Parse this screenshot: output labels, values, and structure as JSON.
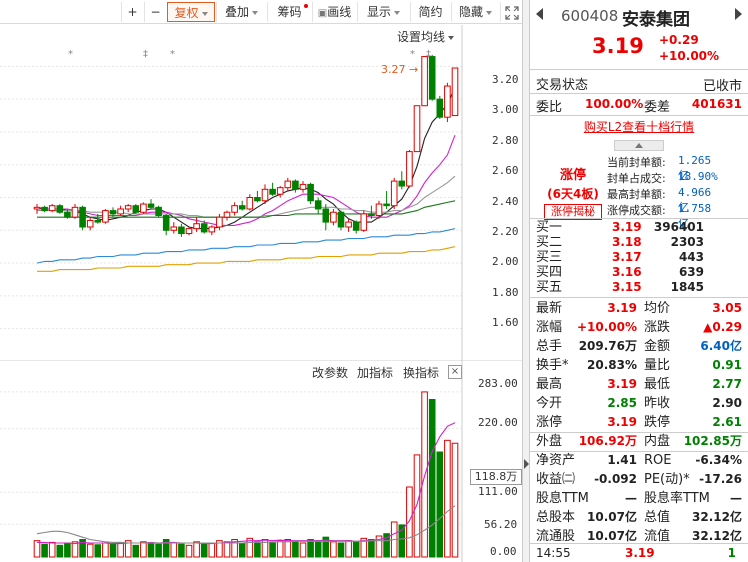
{
  "toolbar": {
    "plus": "+",
    "minus": "−",
    "fuquan": "复权",
    "diejia": "叠加",
    "chouma": "筹码",
    "huaxian": "画线",
    "xianshi": "显示",
    "jianyue": "简约",
    "yincang": "隐藏"
  },
  "chart": {
    "ma_setting": "设置均线",
    "price_high_mark": "3.27",
    "y_ticks": [
      "3.20",
      "3.00",
      "2.80",
      "2.60",
      "2.40",
      "2.20",
      "2.00",
      "1.80",
      "1.60"
    ],
    "vol_tools": {
      "params": "改参数",
      "add": "加指标",
      "swap": "换指标",
      "close": "×"
    },
    "vol_ticks": [
      "283.00",
      "220.00",
      "111.00",
      "56.20",
      "0.00"
    ],
    "vol_current": "118.8万",
    "star": "*"
  },
  "chart_data": {
    "type": "candlestick",
    "ylim": [
      1.5,
      3.3
    ],
    "y_ticks": [
      1.6,
      1.8,
      2.0,
      2.2,
      2.4,
      2.6,
      2.8,
      3.0,
      3.2
    ],
    "candles": [
      [
        2.33,
        2.36,
        2.3,
        2.34
      ],
      [
        2.34,
        2.35,
        2.31,
        2.32
      ],
      [
        2.32,
        2.36,
        2.31,
        2.35
      ],
      [
        2.35,
        2.36,
        2.3,
        2.31
      ],
      [
        2.31,
        2.33,
        2.27,
        2.28
      ],
      [
        2.28,
        2.36,
        2.27,
        2.34
      ],
      [
        2.34,
        2.35,
        2.2,
        2.22
      ],
      [
        2.22,
        2.28,
        2.2,
        2.26
      ],
      [
        2.26,
        2.3,
        2.24,
        2.25
      ],
      [
        2.25,
        2.33,
        2.24,
        2.32
      ],
      [
        2.32,
        2.34,
        2.28,
        2.3
      ],
      [
        2.3,
        2.35,
        2.29,
        2.33
      ],
      [
        2.33,
        2.36,
        2.31,
        2.35
      ],
      [
        2.35,
        2.36,
        2.3,
        2.31
      ],
      [
        2.31,
        2.37,
        2.3,
        2.36
      ],
      [
        2.36,
        2.39,
        2.33,
        2.34
      ],
      [
        2.34,
        2.35,
        2.28,
        2.29
      ],
      [
        2.29,
        2.3,
        2.17,
        2.2
      ],
      [
        2.2,
        2.25,
        2.18,
        2.22
      ],
      [
        2.22,
        2.24,
        2.16,
        2.18
      ],
      [
        2.18,
        2.22,
        2.17,
        2.21
      ],
      [
        2.21,
        2.28,
        2.19,
        2.24
      ],
      [
        2.24,
        2.26,
        2.18,
        2.19
      ],
      [
        2.19,
        2.23,
        2.17,
        2.22
      ],
      [
        2.22,
        2.3,
        2.2,
        2.28
      ],
      [
        2.28,
        2.32,
        2.26,
        2.31
      ],
      [
        2.31,
        2.37,
        2.29,
        2.35
      ],
      [
        2.35,
        2.38,
        2.32,
        2.33
      ],
      [
        2.33,
        2.42,
        2.32,
        2.4
      ],
      [
        2.4,
        2.44,
        2.37,
        2.38
      ],
      [
        2.38,
        2.48,
        2.36,
        2.45
      ],
      [
        2.45,
        2.49,
        2.41,
        2.42
      ],
      [
        2.42,
        2.47,
        2.4,
        2.46
      ],
      [
        2.46,
        2.52,
        2.44,
        2.5
      ],
      [
        2.5,
        2.51,
        2.43,
        2.45
      ],
      [
        2.45,
        2.5,
        2.43,
        2.48
      ],
      [
        2.48,
        2.49,
        2.36,
        2.38
      ],
      [
        2.38,
        2.4,
        2.3,
        2.33
      ],
      [
        2.33,
        2.36,
        2.2,
        2.25
      ],
      [
        2.25,
        2.33,
        2.23,
        2.31
      ],
      [
        2.31,
        2.32,
        2.2,
        2.22
      ],
      [
        2.22,
        2.27,
        2.19,
        2.25
      ],
      [
        2.25,
        2.26,
        2.18,
        2.2
      ],
      [
        2.2,
        2.32,
        2.19,
        2.3
      ],
      [
        2.3,
        2.35,
        2.27,
        2.29
      ],
      [
        2.29,
        2.38,
        2.27,
        2.36
      ],
      [
        2.36,
        2.44,
        2.33,
        2.35
      ],
      [
        2.35,
        2.52,
        2.33,
        2.5
      ],
      [
        2.5,
        2.56,
        2.45,
        2.47
      ],
      [
        2.47,
        2.69,
        2.46,
        2.68
      ],
      [
        2.68,
        2.96,
        2.68,
        2.96
      ],
      [
        2.96,
        3.26,
        2.96,
        3.26
      ],
      [
        3.26,
        3.27,
        2.99,
        3.0
      ],
      [
        3.0,
        3.02,
        2.88,
        2.89
      ],
      [
        2.89,
        3.1,
        2.86,
        3.08
      ],
      [
        2.9,
        3.19,
        2.9,
        3.19
      ]
    ],
    "ma": [
      {
        "color": "#222222",
        "values": [
          2.34,
          2.33,
          2.33,
          2.33,
          2.32,
          2.32,
          2.3,
          2.28,
          2.27,
          2.26,
          2.27,
          2.28,
          2.29,
          2.31,
          2.32,
          2.33,
          2.33,
          2.31,
          2.28,
          2.25,
          2.22,
          2.21,
          2.21,
          2.21,
          2.22,
          2.23,
          2.25,
          2.28,
          2.31,
          2.34,
          2.37,
          2.4,
          2.42,
          2.44,
          2.45,
          2.46,
          2.45,
          2.43,
          2.39,
          2.36,
          2.31,
          2.27,
          2.25,
          2.25,
          2.25,
          2.28,
          2.31,
          2.35,
          2.39,
          2.47,
          2.59,
          2.76,
          2.86,
          2.91,
          2.97,
          3.07
        ]
      },
      {
        "color": "#d020d0",
        "values": [
          2.33,
          2.33,
          2.33,
          2.33,
          2.33,
          2.32,
          2.31,
          2.3,
          2.29,
          2.29,
          2.29,
          2.29,
          2.29,
          2.29,
          2.3,
          2.31,
          2.31,
          2.31,
          2.3,
          2.29,
          2.27,
          2.26,
          2.25,
          2.24,
          2.23,
          2.23,
          2.23,
          2.24,
          2.25,
          2.27,
          2.3,
          2.32,
          2.35,
          2.38,
          2.4,
          2.42,
          2.42,
          2.42,
          2.41,
          2.4,
          2.37,
          2.34,
          2.31,
          2.29,
          2.28,
          2.28,
          2.28,
          2.3,
          2.32,
          2.35,
          2.41,
          2.49,
          2.55,
          2.6,
          2.66,
          2.78
        ]
      },
      {
        "color": "#999999",
        "values": [
          2.32,
          2.32,
          2.32,
          2.32,
          2.32,
          2.32,
          2.32,
          2.31,
          2.31,
          2.31,
          2.31,
          2.31,
          2.3,
          2.3,
          2.3,
          2.3,
          2.3,
          2.3,
          2.3,
          2.3,
          2.29,
          2.29,
          2.28,
          2.28,
          2.28,
          2.28,
          2.28,
          2.28,
          2.28,
          2.28,
          2.29,
          2.29,
          2.3,
          2.31,
          2.32,
          2.33,
          2.34,
          2.34,
          2.34,
          2.34,
          2.33,
          2.33,
          2.32,
          2.32,
          2.31,
          2.31,
          2.31,
          2.32,
          2.32,
          2.34,
          2.36,
          2.4,
          2.43,
          2.46,
          2.49,
          2.53
        ]
      },
      {
        "color": "#1a7a1a",
        "values": [
          2.28,
          2.28,
          2.28,
          2.28,
          2.28,
          2.28,
          2.28,
          2.28,
          2.28,
          2.28,
          2.28,
          2.28,
          2.28,
          2.28,
          2.28,
          2.28,
          2.28,
          2.28,
          2.28,
          2.28,
          2.28,
          2.28,
          2.28,
          2.28,
          2.28,
          2.28,
          2.28,
          2.28,
          2.28,
          2.28,
          2.28,
          2.29,
          2.29,
          2.29,
          2.3,
          2.3,
          2.3,
          2.3,
          2.3,
          2.3,
          2.3,
          2.3,
          2.3,
          2.3,
          2.3,
          2.3,
          2.3,
          2.3,
          2.3,
          2.31,
          2.32,
          2.34,
          2.35,
          2.36,
          2.37,
          2.38
        ]
      },
      {
        "color": "#2a8ad8",
        "values": [
          2.0,
          2.01,
          2.01,
          2.02,
          2.02,
          2.02,
          2.03,
          2.03,
          2.04,
          2.04,
          2.04,
          2.05,
          2.05,
          2.05,
          2.06,
          2.06,
          2.06,
          2.07,
          2.07,
          2.07,
          2.08,
          2.08,
          2.08,
          2.09,
          2.09,
          2.09,
          2.1,
          2.1,
          2.1,
          2.11,
          2.11,
          2.11,
          2.12,
          2.12,
          2.12,
          2.13,
          2.13,
          2.13,
          2.14,
          2.14,
          2.14,
          2.15,
          2.15,
          2.15,
          2.16,
          2.16,
          2.16,
          2.17,
          2.17,
          2.17,
          2.18,
          2.18,
          2.19,
          2.19,
          2.2,
          2.21
        ]
      },
      {
        "color": "#e0a000",
        "values": [
          1.95,
          1.95,
          1.95,
          1.96,
          1.96,
          1.96,
          1.96,
          1.96,
          1.97,
          1.97,
          1.97,
          1.97,
          1.98,
          1.98,
          1.98,
          1.98,
          1.98,
          1.99,
          1.99,
          1.99,
          1.99,
          2.0,
          2.0,
          2.0,
          2.0,
          2.01,
          2.01,
          2.01,
          2.01,
          2.02,
          2.02,
          2.02,
          2.02,
          2.03,
          2.03,
          2.03,
          2.03,
          2.04,
          2.04,
          2.04,
          2.04,
          2.05,
          2.05,
          2.05,
          2.05,
          2.06,
          2.06,
          2.06,
          2.06,
          2.07,
          2.07,
          2.07,
          2.08,
          2.08,
          2.09,
          2.1
        ]
      }
    ],
    "volume": {
      "ylim": [
        0,
        300
      ],
      "values": [
        28,
        22,
        25,
        20,
        24,
        26,
        30,
        22,
        21,
        24,
        22,
        25,
        28,
        20,
        26,
        24,
        22,
        30,
        24,
        22,
        20,
        26,
        22,
        24,
        28,
        26,
        30,
        24,
        32,
        26,
        30,
        24,
        28,
        30,
        26,
        24,
        30,
        28,
        34,
        26,
        24,
        28,
        26,
        32,
        30,
        36,
        40,
        60,
        55,
        120,
        175,
        283,
        270,
        180,
        200,
        195
      ],
      "ma": [
        {
          "color": "#d020d0",
          "values": [
            25,
            25,
            24,
            24,
            24,
            23,
            25,
            24,
            24,
            24,
            23,
            23,
            24,
            24,
            24,
            25,
            24,
            25,
            25,
            24,
            24,
            24,
            23,
            23,
            24,
            25,
            26,
            27,
            28,
            28,
            29,
            28,
            29,
            28,
            28,
            28,
            28,
            28,
            29,
            28,
            28,
            28,
            27,
            28,
            28,
            30,
            33,
            40,
            46,
            62,
            90,
            139,
            181,
            206,
            224,
            230
          ]
        },
        {
          "color": "#888888",
          "values": [
            40,
            42,
            44,
            44,
            42,
            38,
            34,
            30,
            28,
            26,
            25,
            25,
            24,
            24,
            24,
            24,
            24,
            24,
            24,
            24,
            24,
            24,
            24,
            24,
            24,
            24,
            24,
            24,
            25,
            25,
            25,
            26,
            26,
            26,
            27,
            27,
            27,
            27,
            27,
            27,
            27,
            27,
            27,
            27,
            28,
            28,
            28,
            30,
            31,
            33,
            38,
            46,
            55,
            66,
            78,
            88
          ]
        }
      ]
    }
  },
  "quote": {
    "code": "600408",
    "name": "安泰集团",
    "price": "3.19",
    "change": "+0.29",
    "change_pct": "+10.00%",
    "status_label": "交易状态",
    "status_value": "已收市",
    "weibi_label": "委比",
    "weibi_value": "100.00%",
    "weicha_label": "委差",
    "weicha_value": "401631",
    "l2_link": "购买L2查看十档行情",
    "limit_title": "涨停",
    "limit_sub": "(6天4板)",
    "limit_btn": "涨停揭秘",
    "seal": [
      {
        "label": "当前封单额:",
        "value": "1.265亿"
      },
      {
        "label": "封单占成交:",
        "value": "18.90%"
      },
      {
        "label": "最高封单额:",
        "value": "4.966亿"
      },
      {
        "label": "涨停成交额:",
        "value": "1.758亿"
      }
    ],
    "bids": [
      {
        "label": "买一",
        "price": "3.19",
        "vol": "396401"
      },
      {
        "label": "买二",
        "price": "3.18",
        "vol": "2303"
      },
      {
        "label": "买三",
        "price": "3.17",
        "vol": "443"
      },
      {
        "label": "买四",
        "price": "3.16",
        "vol": "639"
      },
      {
        "label": "买五",
        "price": "3.15",
        "vol": "1845"
      }
    ],
    "stats": [
      {
        "l1": "最新",
        "v1": "3.19",
        "c1": "red",
        "l2": "均价",
        "v2": "3.05",
        "c2": "red"
      },
      {
        "l1": "涨幅",
        "v1": "+10.00%",
        "c1": "red",
        "l2": "涨跌",
        "v2": "▲0.29",
        "c2": "red"
      },
      {
        "l1": "总手",
        "v1": "209.76万",
        "c1": "black",
        "l2": "金额",
        "v2": "6.40亿",
        "c2": "blue"
      },
      {
        "l1": "换手*",
        "v1": "20.83%",
        "c1": "black",
        "l2": "量比",
        "v2": "0.91",
        "c2": "green"
      },
      {
        "l1": "最高",
        "v1": "3.19",
        "c1": "red",
        "l2": "最低",
        "v2": "2.77",
        "c2": "green"
      },
      {
        "l1": "今开",
        "v1": "2.85",
        "c1": "green",
        "l2": "昨收",
        "v2": "2.90",
        "c2": "black"
      },
      {
        "l1": "涨停",
        "v1": "3.19",
        "c1": "red",
        "l2": "跌停",
        "v2": "2.61",
        "c2": "green"
      },
      {
        "l1": "外盘",
        "v1": "106.92万",
        "c1": "red",
        "l2": "内盘",
        "v2": "102.85万",
        "c2": "green"
      },
      {
        "l1": "净资产",
        "v1": "1.41",
        "c1": "black",
        "l2": "ROE",
        "v2": "-6.34%",
        "c2": "black"
      },
      {
        "l1": "收益㈡",
        "v1": "-0.092",
        "c1": "black",
        "l2": "PE(动)*",
        "v2": "-17.26",
        "c2": "black"
      },
      {
        "l1": "股息TTM",
        "v1": "—",
        "c1": "black",
        "l2": "股息率TTM",
        "v2": "—",
        "c2": "black"
      },
      {
        "l1": "总股本",
        "v1": "10.07亿",
        "c1": "black",
        "l2": "总值",
        "v2": "32.12亿",
        "c2": "black"
      },
      {
        "l1": "流通股",
        "v1": "10.07亿",
        "c1": "black",
        "l2": "流值",
        "v2": "32.12亿",
        "c2": "black"
      }
    ],
    "tick_time": "14:55",
    "tick_price": "3.19",
    "tick_vol": "1"
  },
  "colors": {
    "up": "#e00000",
    "down": "#008000",
    "accent": "#e55a1f",
    "blue": "#0060c0"
  },
  "icons": {
    "back": "triangle-left-icon",
    "forward": "triangle-right-icon",
    "expand": "fullscreen-icon"
  }
}
